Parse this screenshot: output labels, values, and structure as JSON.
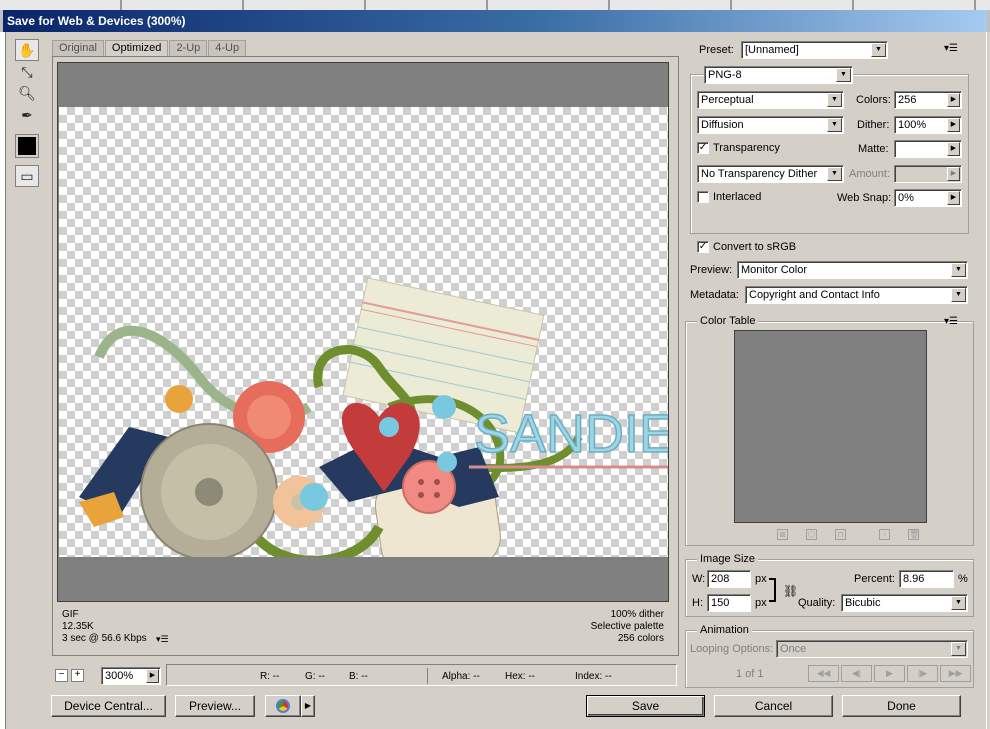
{
  "window": {
    "title": "Save for Web & Devices (300%)"
  },
  "tabs": [
    {
      "label": "Original"
    },
    {
      "label": "Optimized"
    },
    {
      "label": "2-Up"
    },
    {
      "label": "4-Up"
    }
  ],
  "preview": {
    "watermark_text": "SANDIE",
    "info_left": {
      "format": "GIF",
      "size": "12.35K",
      "time": "3 sec @ 56.6 Kbps"
    },
    "info_right": {
      "dither": "100% dither",
      "palette": "Selective palette",
      "colors": "256 colors"
    }
  },
  "zoom": {
    "value": "300%"
  },
  "statusbar": {
    "r": "R: --",
    "g": "G: --",
    "b": "B: --",
    "alpha": "Alpha: --",
    "hex": "Hex: --",
    "index": "Index: --"
  },
  "settings": {
    "preset_label": "Preset:",
    "preset_value": "[Unnamed]",
    "format": "PNG-8",
    "reduction": "Perceptual",
    "colors_label": "Colors:",
    "colors_value": "256",
    "dither_algo": "Diffusion",
    "dither_label": "Dither:",
    "dither_value": "100%",
    "transparency_label": "Transparency",
    "matte_label": "Matte:",
    "trans_dither": "No Transparency Dither",
    "amount_label": "Amount:",
    "interlaced_label": "Interlaced",
    "websnap_label": "Web Snap:",
    "websnap_value": "0%",
    "convert_label": "Convert to sRGB",
    "preview_label": "Preview:",
    "preview_value": "Monitor Color",
    "metadata_label": "Metadata:",
    "metadata_value": "Copyright and Contact Info"
  },
  "color_table": {
    "title": "Color Table"
  },
  "image_size": {
    "title": "Image Size",
    "w_label": "W:",
    "w_value": "208",
    "w_unit": "px",
    "h_label": "H:",
    "h_value": "150",
    "h_unit": "px",
    "percent_label": "Percent:",
    "percent_value": "8.96",
    "percent_unit": "%",
    "quality_label": "Quality:",
    "quality_value": "Bicubic"
  },
  "animation": {
    "title": "Animation",
    "looping_label": "Looping Options:",
    "looping_value": "Once",
    "frame_count": "1 of 1"
  },
  "buttons": {
    "device_central": "Device Central...",
    "preview": "Preview...",
    "save": "Save",
    "cancel": "Cancel",
    "done": "Done"
  }
}
